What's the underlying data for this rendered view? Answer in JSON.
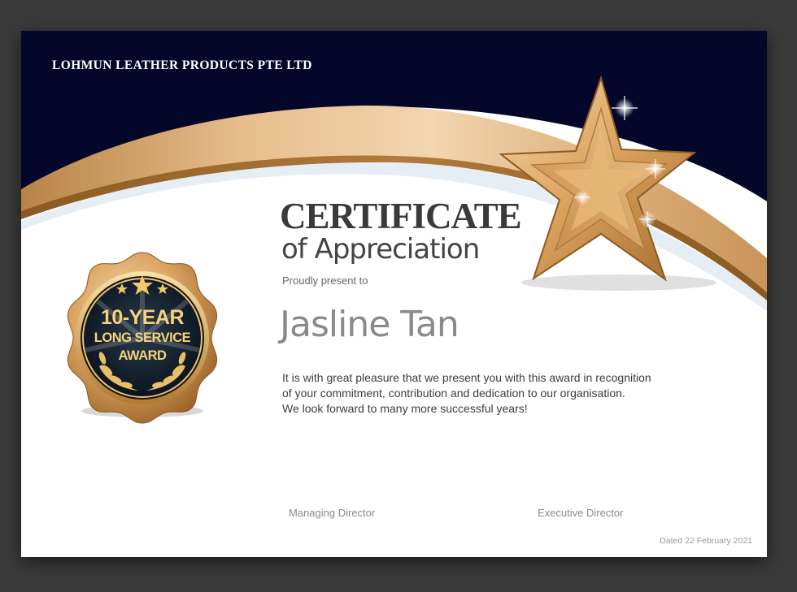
{
  "certificate": {
    "company": "LOHMUN LEATHER PRODUCTS PTE LTD",
    "title_main": "CERTIFICATE",
    "title_sub": "of Appreciation",
    "present_line": "Proudly present to",
    "recipient": "Jasline Tan",
    "message_lines": [
      "It is with great pleasure that we present you with this award in recognition",
      "of your commitment, contribution and dedication to our organisation.",
      "We look forward to many more successful years!"
    ],
    "signatories": [
      "Managing Director",
      "Executive Director"
    ],
    "dated": "Dated 22 February 2021"
  },
  "badge": {
    "line_1": "10-YEAR",
    "line_2": "LONG SERVICE",
    "line_3": "AWARD",
    "icons": [
      "star-icon",
      "laurel-icon"
    ]
  },
  "colors": {
    "navy": "#04062a",
    "gold": "#e2b57e",
    "gold_dark": "#9a6a34",
    "text_dark": "#3a3a3a",
    "recipient_gray": "#8a8a8a"
  }
}
